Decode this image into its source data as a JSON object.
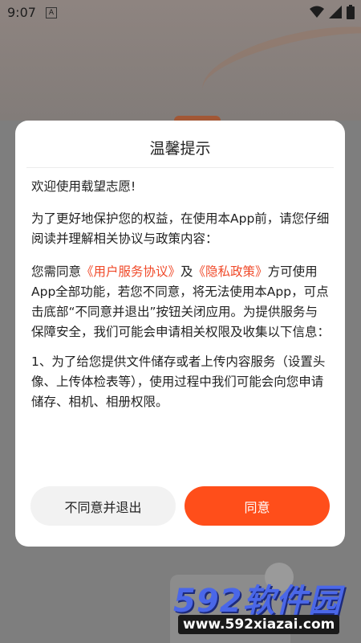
{
  "status_bar": {
    "time": "9:07",
    "notification_glyph": "A",
    "icons": [
      "wifi-icon",
      "signal-icon",
      "battery-icon"
    ]
  },
  "dialog": {
    "title": "温馨提示",
    "welcome": "欢迎使用载望志愿!",
    "purpose": "为了更好地保护您的权益，在使用本App前，请您仔细阅读并理解相关协议与政策内容：",
    "consent_prefix": "您需同意",
    "user_agreement_link": "《用户服务协议》",
    "consent_and": "及",
    "privacy_policy_link": "《隐私政策》",
    "consent_suffix": "方可使用App全部功能，若您不同意，将无法使用本App，可点击底部“不同意并退出”按钮关闭应用。为提供服务与保障安全，我们可能会申请相关权限及收集以下信息：",
    "item_1": "1、为了给您提供文件储存或者上传内容服务（设置头像、上传体检表等），使用过程中我们可能会向您申请储存、相机、相册权限。",
    "decline_button": "不同意并退出",
    "agree_button": "同意"
  },
  "watermark": {
    "logo_text": "592软件园",
    "url": "www.592xiazai.com"
  },
  "colors": {
    "accent": "#ff4e1a",
    "link": "#f04a2a",
    "overlay": "#7e7e7e"
  }
}
